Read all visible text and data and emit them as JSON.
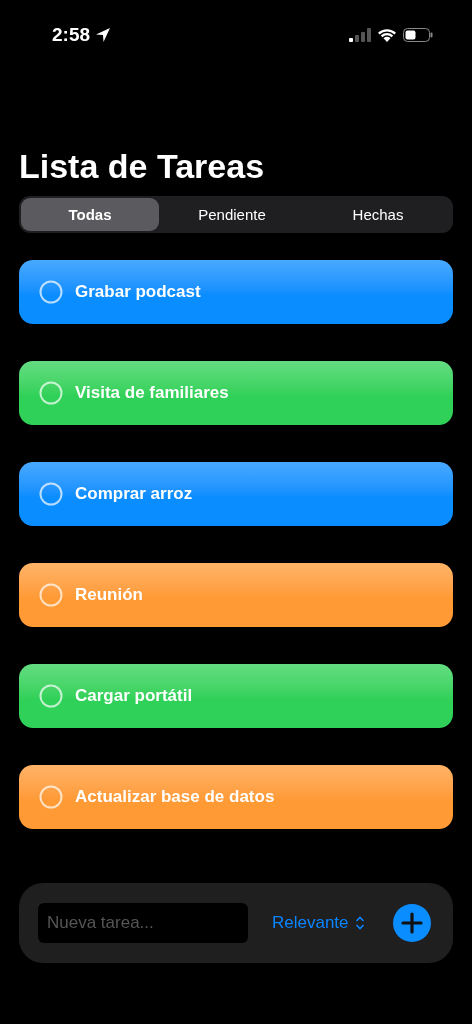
{
  "status_bar": {
    "time": "2:58"
  },
  "title": "Lista de Tareas",
  "tabs": [
    {
      "label": "Todas",
      "selected": true
    },
    {
      "label": "Pendiente",
      "selected": false
    },
    {
      "label": "Hechas",
      "selected": false
    }
  ],
  "tasks": [
    {
      "title": "Grabar podcast",
      "done": false,
      "color": "#0a8dff"
    },
    {
      "title": "Visita de familiares",
      "done": false,
      "color": "#30d158"
    },
    {
      "title": "Comprar arroz",
      "done": false,
      "color": "#0a8dff"
    },
    {
      "title": "Reunión",
      "done": false,
      "color": "#ff9a35"
    },
    {
      "title": "Cargar portátil",
      "done": false,
      "color": "#30d158"
    },
    {
      "title": "Actualizar base de datos",
      "done": false,
      "color": "#ff9a35"
    }
  ],
  "new_task": {
    "placeholder": "Nueva tarea..."
  },
  "sort": {
    "label": "Relevante"
  }
}
